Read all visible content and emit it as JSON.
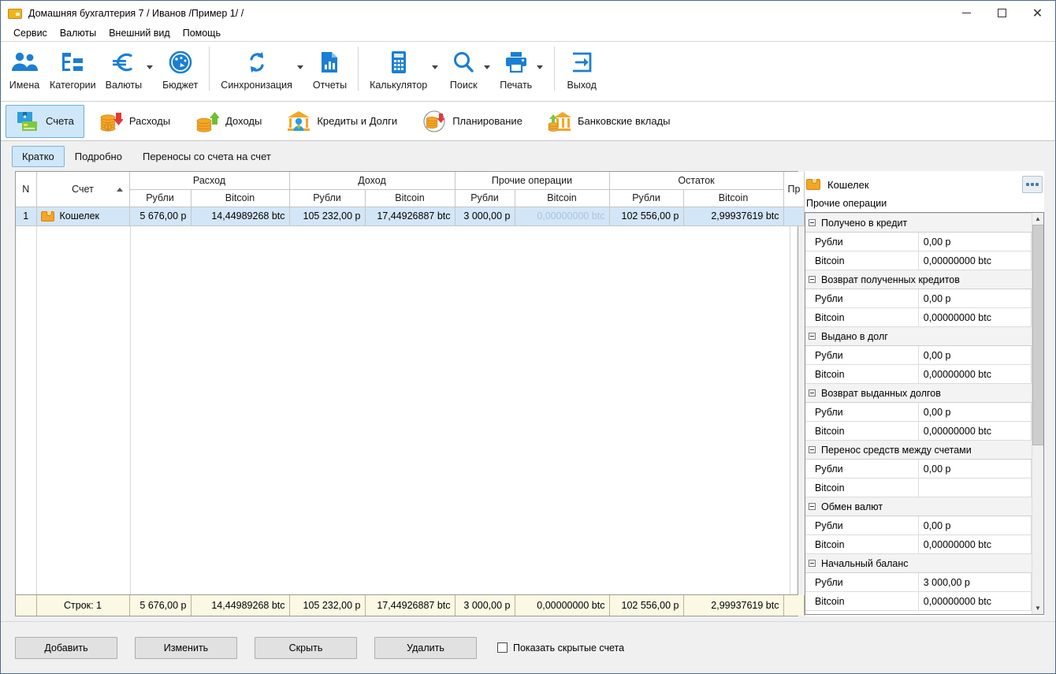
{
  "window": {
    "title": "Домашняя бухгалтерия 7  / Иванов /Пример 1/ /",
    "app_icon": "wallet-icon",
    "minimize": "minimize-icon",
    "maximize": "maximize-icon",
    "close": "close-icon"
  },
  "menubar": {
    "items": [
      {
        "label": "Сервис"
      },
      {
        "label": "Валюты"
      },
      {
        "label": "Внешний вид"
      },
      {
        "label": "Помощь"
      }
    ]
  },
  "toolbar": {
    "groups": [
      {
        "items": [
          {
            "label": "Имена",
            "icon": "people-icon",
            "dropdown": false
          },
          {
            "label": "Категории",
            "icon": "tree-list-icon",
            "dropdown": false
          },
          {
            "label": "Валюты",
            "icon": "euro-icon",
            "dropdown": true
          },
          {
            "label": "Бюджет",
            "icon": "gauge-icon",
            "dropdown": false
          }
        ]
      },
      {
        "items": [
          {
            "label": "Синхронизация",
            "icon": "sync-icon",
            "dropdown": true
          },
          {
            "label": "Отчеты",
            "icon": "report-document-icon",
            "dropdown": false
          }
        ]
      },
      {
        "items": [
          {
            "label": "Калькулятор",
            "icon": "calculator-icon",
            "dropdown": true
          },
          {
            "label": "Поиск",
            "icon": "search-icon",
            "dropdown": true
          },
          {
            "label": "Печать",
            "icon": "printer-icon",
            "dropdown": true
          }
        ]
      },
      {
        "items": [
          {
            "label": "Выход",
            "icon": "exit-icon",
            "dropdown": false
          }
        ]
      }
    ]
  },
  "category_tabs": {
    "active_index": 0,
    "items": [
      {
        "label": "Счета",
        "icon": "accounts-icon"
      },
      {
        "label": "Расходы",
        "icon": "expenses-coins-down-icon"
      },
      {
        "label": "Доходы",
        "icon": "income-coins-up-icon"
      },
      {
        "label": "Кредиты и Долги",
        "icon": "bank-person-icon"
      },
      {
        "label": "Планирование",
        "icon": "planning-clock-icon"
      },
      {
        "label": "Банковские вклады",
        "icon": "bank-deposit-icon"
      }
    ]
  },
  "sub_tabs": {
    "active_index": 0,
    "items": [
      {
        "label": "Кратко"
      },
      {
        "label": "Подробно"
      },
      {
        "label": "Переносы со счета на счет"
      }
    ]
  },
  "grid": {
    "group_headers": [
      {
        "label": "",
        "span": 1
      },
      {
        "label": "",
        "span": 1
      },
      {
        "label": "Расход",
        "span": 2
      },
      {
        "label": "Доход",
        "span": 2
      },
      {
        "label": "Прочие операции",
        "span": 2
      },
      {
        "label": "Остаток",
        "span": 2
      },
      {
        "label": "Пр",
        "span": 1
      }
    ],
    "columns": [
      {
        "label": "N"
      },
      {
        "label": "Счет",
        "sort": "asc"
      },
      {
        "label": "Рубли"
      },
      {
        "label": "Bitcoin"
      },
      {
        "label": "Рубли"
      },
      {
        "label": "Bitcoin"
      },
      {
        "label": "Рубли"
      },
      {
        "label": "Bitcoin"
      },
      {
        "label": "Рубли"
      },
      {
        "label": "Bitcoin"
      },
      {
        "label": ""
      }
    ],
    "rows": [
      {
        "n": "1",
        "account": "Кошелек",
        "account_icon": "wallet-icon",
        "expense_rub": "5 676,00 р",
        "expense_btc": "14,44989268 btc",
        "income_rub": "105 232,00 р",
        "income_btc": "17,44926887 btc",
        "other_rub": "3 000,00 р",
        "other_btc": "0,00000000 btc",
        "other_btc_dim": true,
        "balance_rub": "102 556,00 р",
        "balance_btc": "2,99937619 btc",
        "extra": "",
        "selected": true
      }
    ],
    "footer": {
      "rows_label": "Строк: 1",
      "expense_rub": "5 676,00 р",
      "expense_btc": "14,44989268 btc",
      "income_rub": "105 232,00 р",
      "income_btc": "17,44926887 btc",
      "other_rub": "3 000,00 р",
      "other_btc": "0,00000000 btc",
      "balance_rub": "102 556,00 р",
      "balance_btc": "2,99937619 btc",
      "extra": ""
    }
  },
  "right_panel": {
    "title": "Кошелек",
    "title_icon": "wallet-icon",
    "more_button": "more-options-icon",
    "subtitle": "Прочие операции",
    "groups": [
      {
        "label": "Получено в кредит",
        "rows": [
          {
            "key": "Рубли",
            "value": "0,00 р"
          },
          {
            "key": "Bitcoin",
            "value": "0,00000000 btc"
          }
        ]
      },
      {
        "label": "Возврат полученных кредитов",
        "rows": [
          {
            "key": "Рубли",
            "value": "0,00 р"
          },
          {
            "key": "Bitcoin",
            "value": "0,00000000 btc"
          }
        ]
      },
      {
        "label": "Выдано в долг",
        "rows": [
          {
            "key": "Рубли",
            "value": "0,00 р"
          },
          {
            "key": "Bitcoin",
            "value": "0,00000000 btc"
          }
        ]
      },
      {
        "label": "Возврат выданных долгов",
        "rows": [
          {
            "key": "Рубли",
            "value": "0,00 р"
          },
          {
            "key": "Bitcoin",
            "value": "0,00000000 btc"
          }
        ]
      },
      {
        "label": "Перенос средств между счетами",
        "rows": [
          {
            "key": "Рубли",
            "value": "0,00 р"
          },
          {
            "key": "Bitcoin",
            "value": ""
          }
        ]
      },
      {
        "label": "Обмен валют",
        "rows": [
          {
            "key": "Рубли",
            "value": "0,00 р"
          },
          {
            "key": "Bitcoin",
            "value": "0,00000000 btc"
          }
        ]
      },
      {
        "label": "Начальный баланс",
        "rows": [
          {
            "key": "Рубли",
            "value": "3 000,00 р"
          },
          {
            "key": "Bitcoin",
            "value": "0,00000000 btc"
          }
        ]
      }
    ],
    "scroll_up": "▲",
    "scroll_down": "▼"
  },
  "bottom_bar": {
    "buttons": [
      {
        "label": "Добавить"
      },
      {
        "label": "Изменить"
      },
      {
        "label": "Скрыть"
      },
      {
        "label": "Удалить"
      }
    ],
    "checkbox": {
      "label": "Показать скрытые счета",
      "checked": false
    }
  },
  "colors": {
    "accent_blue": "#1a7fd4",
    "selection": "#d3e6f7",
    "tab_active": "#cfe7f9",
    "footer_bg": "#fbf8e3",
    "orange": "#f5a623"
  }
}
